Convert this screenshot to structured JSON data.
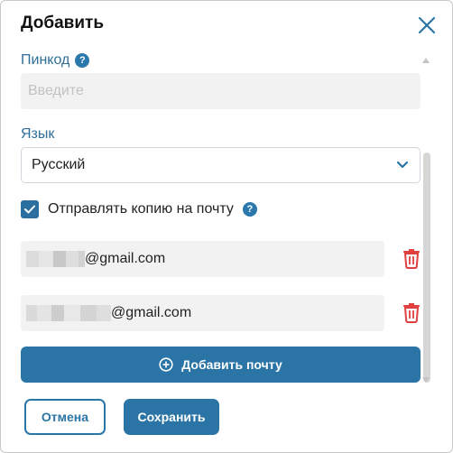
{
  "dialog": {
    "title": "Добавить"
  },
  "pin": {
    "label": "Пинкод",
    "placeholder": "Введите",
    "value": ""
  },
  "language": {
    "label": "Язык",
    "selected": "Русский"
  },
  "send_copy": {
    "label": "Отправлять копию на почту",
    "checked": true
  },
  "emails": [
    {
      "domain": "@gmail.com"
    },
    {
      "domain": "@gmail.com"
    }
  ],
  "add_email_label": "Добавить почту",
  "buttons": {
    "cancel": "Отмена",
    "save": "Сохранить"
  },
  "icons": {
    "close": "close-icon",
    "help": "help-icon",
    "chevron": "chevron-down-icon",
    "check": "check-icon",
    "trash": "trash-icon",
    "add": "plus-circle-icon"
  },
  "colors": {
    "primary": "#2b74a6",
    "label": "#2f6f98",
    "danger": "#e04040"
  }
}
